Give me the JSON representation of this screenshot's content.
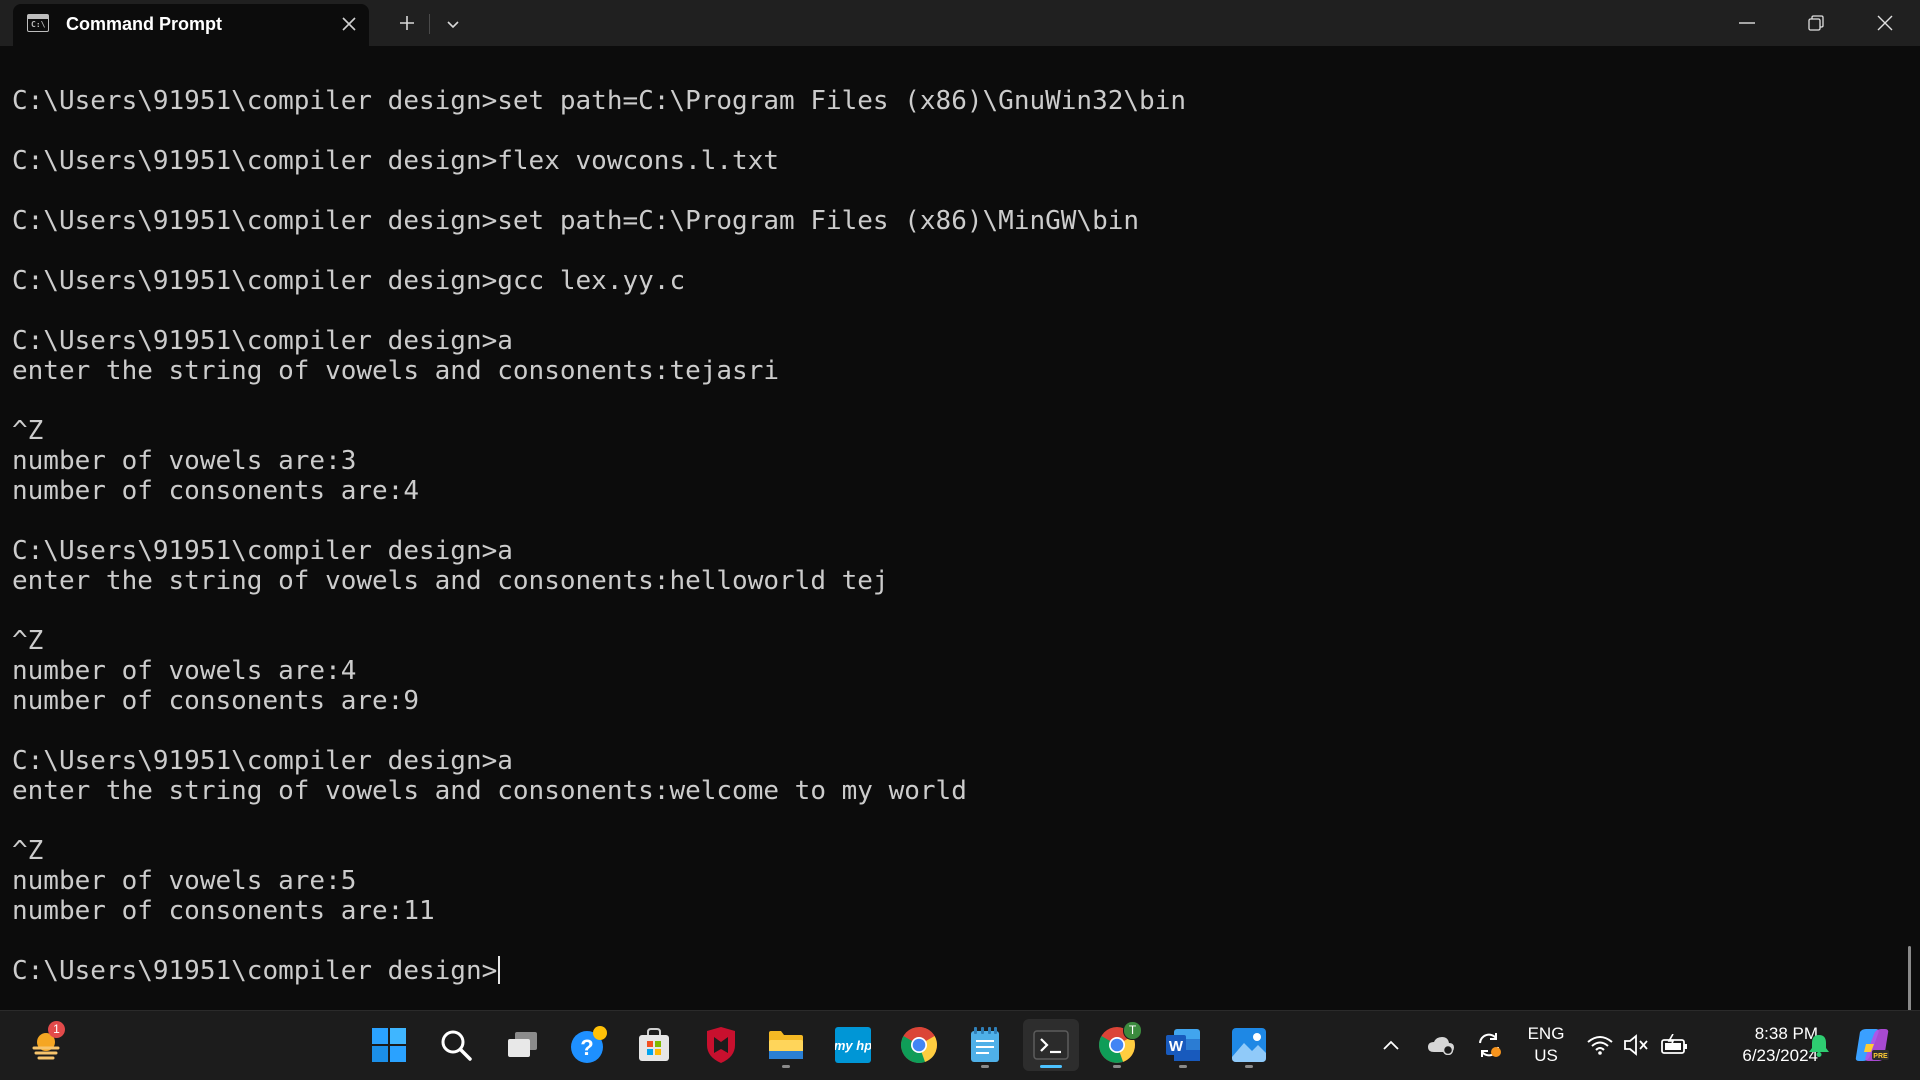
{
  "window": {
    "tab_title": "Command Prompt",
    "colors": {
      "titlebar": "#202020",
      "terminal_bg": "#0c0c0c",
      "terminal_fg": "#cccccc",
      "accent": "#4cc2ff"
    }
  },
  "terminal": {
    "lines": [
      "C:\\Users\\91951\\compiler design>set path=C:\\Program Files (x86)\\GnuWin32\\bin",
      "",
      "C:\\Users\\91951\\compiler design>flex vowcons.l.txt",
      "",
      "C:\\Users\\91951\\compiler design>set path=C:\\Program Files (x86)\\MinGW\\bin",
      "",
      "C:\\Users\\91951\\compiler design>gcc lex.yy.c",
      "",
      "C:\\Users\\91951\\compiler design>a",
      "enter the string of vowels and consonents:tejasri",
      "",
      "^Z",
      "number of vowels are:3",
      "number of consonents are:4",
      "",
      "C:\\Users\\91951\\compiler design>a",
      "enter the string of vowels and consonents:helloworld tej",
      "",
      "^Z",
      "number of vowels are:4",
      "number of consonents are:9",
      "",
      "C:\\Users\\91951\\compiler design>a",
      "enter the string of vowels and consonents:welcome to my world",
      "",
      "^Z",
      "number of vowels are:5",
      "number of consonents are:11",
      ""
    ],
    "prompt": "C:\\Users\\91951\\compiler design>"
  },
  "taskbar": {
    "widgets_badge": "1",
    "chrome_profile_badge": "T",
    "apps": [
      "start-icon",
      "search-icon",
      "task-view-icon",
      "help-icon",
      "microsoft-store-icon",
      "mcafee-icon",
      "file-explorer-icon",
      "myhp-icon",
      "chrome-icon",
      "notepad-icon",
      "terminal-icon",
      "chrome-profile-icon",
      "word-icon",
      "photos-icon"
    ],
    "language": {
      "line1": "ENG",
      "line2": "US"
    },
    "time": "8:38 PM",
    "date": "6/23/2024"
  }
}
